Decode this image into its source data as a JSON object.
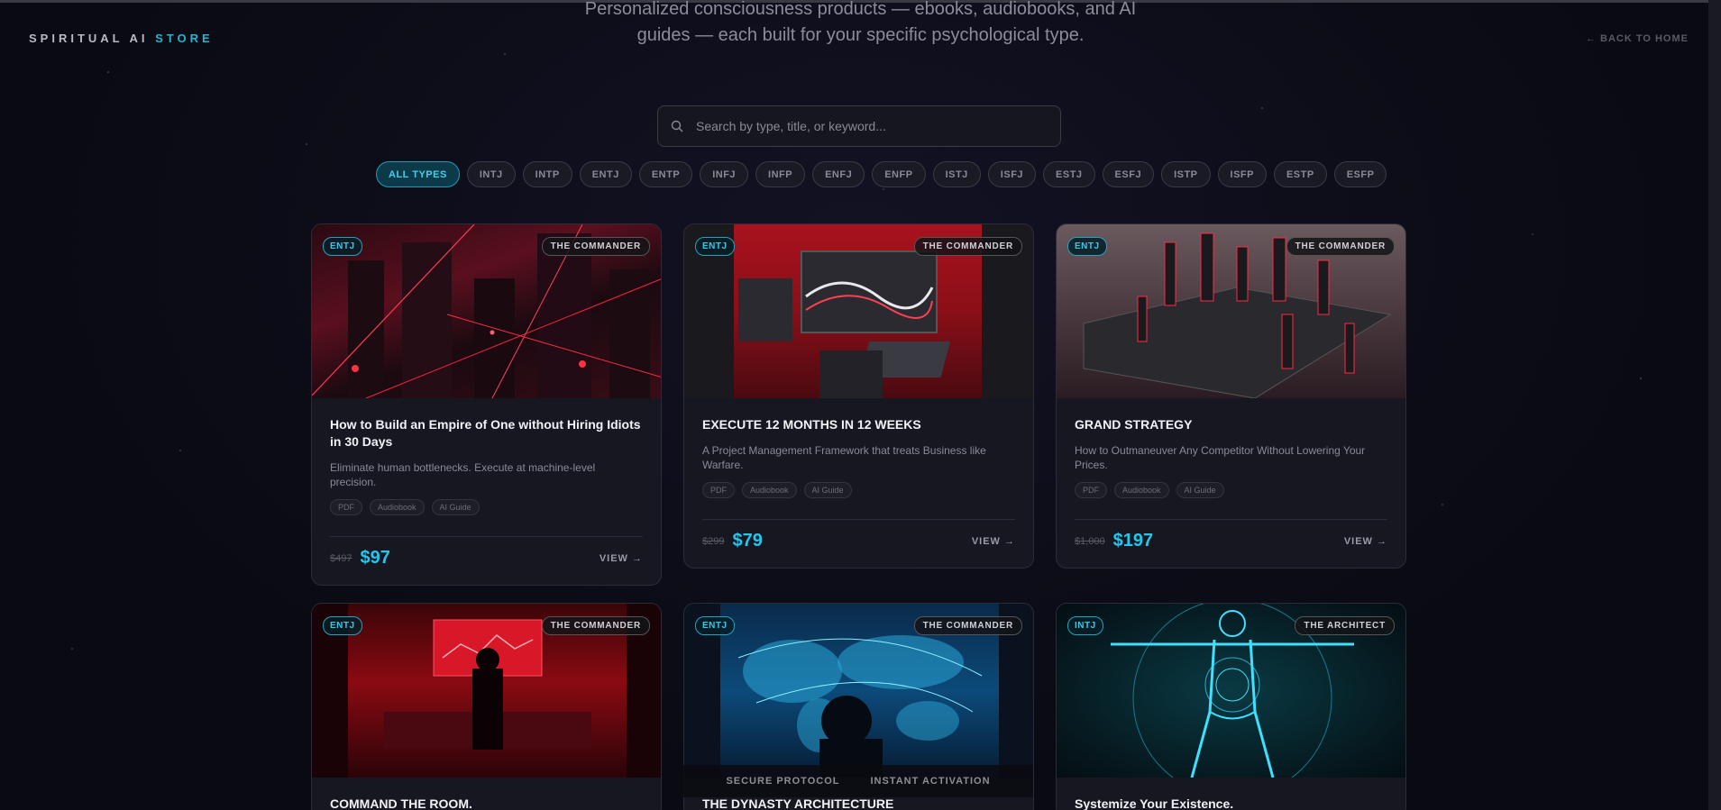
{
  "header": {
    "brand_main": "SPIRITUAL AI",
    "brand_accent": "STORE",
    "back_link": "← BACK TO HOME"
  },
  "hero": {
    "subtitle_line1": "Personalized consciousness products — ebooks, audiobooks, and AI",
    "subtitle_line2": "guides — each built for your specific psychological type."
  },
  "search": {
    "placeholder": "Search by type, title, or keyword..."
  },
  "filters": [
    "ALL TYPES",
    "INTJ",
    "INTP",
    "ENTJ",
    "ENTP",
    "INFJ",
    "INFP",
    "ENFJ",
    "ENFP",
    "ISTJ",
    "ISFJ",
    "ESTJ",
    "ESFJ",
    "ISTP",
    "ISFP",
    "ESTP",
    "ESFP"
  ],
  "active_filter": "ALL TYPES",
  "products": [
    {
      "type": "ENTJ",
      "persona": "THE COMMANDER",
      "title": "How to Build an Empire of One without Hiring Idiots in 30 Days",
      "desc": "Eliminate human bottlenecks. Execute at machine-level precision.",
      "formats": [
        "PDF",
        "Audiobook",
        "AI Guide"
      ],
      "old_price": "$497",
      "price": "$97",
      "view": "VIEW →"
    },
    {
      "type": "ENTJ",
      "persona": "THE COMMANDER",
      "title": "EXECUTE 12 MONTHS IN 12 WEEKS",
      "desc": "A Project Management Framework that treats Business like Warfare.",
      "formats": [
        "PDF",
        "Audiobook",
        "AI Guide"
      ],
      "old_price": "$299",
      "price": "$79",
      "view": "VIEW →"
    },
    {
      "type": "ENTJ",
      "persona": "THE COMMANDER",
      "title": "GRAND STRATEGY",
      "desc": "How to Outmaneuver Any Competitor Without Lowering Your Prices.",
      "formats": [
        "PDF",
        "Audiobook",
        "AI Guide"
      ],
      "old_price": "$1,000",
      "price": "$197",
      "view": "VIEW →"
    },
    {
      "type": "ENTJ",
      "persona": "THE COMMANDER",
      "title": "COMMAND THE ROOM."
    },
    {
      "type": "ENTJ",
      "persona": "THE COMMANDER",
      "title": "THE DYNASTY ARCHITECTURE"
    },
    {
      "type": "INTJ",
      "persona": "THE ARCHITECT",
      "title": "Systemize Your Existence."
    }
  ],
  "footer": {
    "secure": "SECURE PROTOCOL",
    "instant": "INSTANT ACTIVATION"
  },
  "colors": {
    "accent": "#22c8ec",
    "background": "#0b0b14",
    "card": "#171722"
  }
}
